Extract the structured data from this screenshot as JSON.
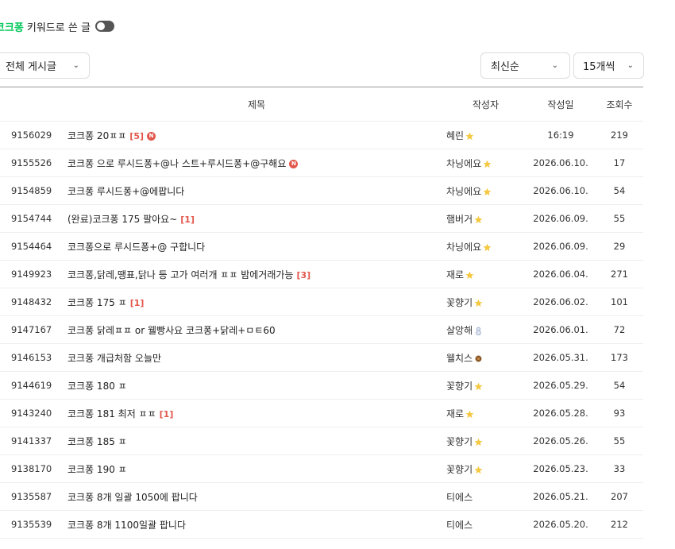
{
  "keyword_filter": {
    "keyword": "코크퐁",
    "label": "키워드로 쓴 글",
    "toggle_on": false
  },
  "filters": {
    "board_select": "전체 게시글",
    "sort_select": "최신순",
    "count_select": "15개씩"
  },
  "table": {
    "headers": {
      "title": "제목",
      "author": "작성자",
      "date": "작성일",
      "views": "조회수"
    },
    "rows": [
      {
        "num": "9156029",
        "title": "코크퐁 20ㅍㅍ",
        "comments": "[5]",
        "is_new": true,
        "new_label": "N",
        "author": "혜린",
        "level_icon": "star-level-icon",
        "date": "16:19",
        "views": "219"
      },
      {
        "num": "9155526",
        "title": "코크퐁 으로 루시드퐁+@나 스트+루시드퐁+@구해요",
        "comments": "",
        "is_new": true,
        "new_label": "N",
        "author": "차닝에요",
        "level_icon": "star-level-icon",
        "date": "2026.06.10.",
        "views": "17"
      },
      {
        "num": "9154859",
        "title": "코크퐁 루시드퐁+@에팝니다",
        "comments": "",
        "is_new": false,
        "new_label": "",
        "author": "차닝에요",
        "level_icon": "star-level-icon",
        "date": "2026.06.10.",
        "views": "54"
      },
      {
        "num": "9154744",
        "title": "(완료)코크퐁 175 팔아요~",
        "comments": "[1]",
        "is_new": false,
        "new_label": "",
        "author": "햄버거",
        "level_icon": "star-level-icon",
        "date": "2026.06.09.",
        "views": "55"
      },
      {
        "num": "9154464",
        "title": "코크퐁으로 루시드퐁+@ 구합니다",
        "comments": "",
        "is_new": false,
        "new_label": "",
        "author": "차닝에요",
        "level_icon": "star-level-icon",
        "date": "2026.06.09.",
        "views": "29"
      },
      {
        "num": "9149923",
        "title": "코크퐁,닭레,땡표,닭나 등 고가 여러개 ㅍㅍ 밤에거래가능",
        "comments": "[3]",
        "is_new": false,
        "new_label": "",
        "author": "재로",
        "level_icon": "star-level-icon",
        "date": "2026.06.04.",
        "views": "271"
      },
      {
        "num": "9148432",
        "title": "코크퐁 175 ㅍ",
        "comments": "[1]",
        "is_new": false,
        "new_label": "",
        "author": "꽃향기",
        "level_icon": "star-level-icon",
        "date": "2026.06.02.",
        "views": "101"
      },
      {
        "num": "9147167",
        "title": "코크퐁 닭레ㅍㅍ or 웰빵사요 코크퐁+닭레+ㅁㅌ60",
        "comments": "",
        "is_new": false,
        "new_label": "",
        "author": "살앙해",
        "level_icon": "snowman-level-icon",
        "date": "2026.06.01.",
        "views": "72"
      },
      {
        "num": "9146153",
        "title": "코크퐁 개급처함 오늘만",
        "comments": "",
        "is_new": false,
        "new_label": "",
        "author": "웰치스",
        "level_icon": "acorn-level-icon",
        "date": "2026.05.31.",
        "views": "173"
      },
      {
        "num": "9144619",
        "title": "코크퐁 180 ㅍ",
        "comments": "",
        "is_new": false,
        "new_label": "",
        "author": "꽃향기",
        "level_icon": "star-level-icon",
        "date": "2026.05.29.",
        "views": "54"
      },
      {
        "num": "9143240",
        "title": "코크퐁 181 최저 ㅍㅍ",
        "comments": "[1]",
        "is_new": false,
        "new_label": "",
        "author": "재로",
        "level_icon": "star-level-icon",
        "date": "2026.05.28.",
        "views": "93"
      },
      {
        "num": "9141337",
        "title": "코크퐁 185 ㅍ",
        "comments": "",
        "is_new": false,
        "new_label": "",
        "author": "꽃향기",
        "level_icon": "star-level-icon",
        "date": "2026.05.26.",
        "views": "55"
      },
      {
        "num": "9138170",
        "title": "코크퐁 190 ㅍ",
        "comments": "",
        "is_new": false,
        "new_label": "",
        "author": "꽃향기",
        "level_icon": "star-level-icon",
        "date": "2026.05.23.",
        "views": "33"
      },
      {
        "num": "9135587",
        "title": "코크퐁 8개 일괄 1050에 팝니다",
        "comments": "",
        "is_new": false,
        "new_label": "",
        "author": "티에스",
        "level_icon": "",
        "date": "2026.05.21.",
        "views": "207"
      },
      {
        "num": "9135539",
        "title": "코크퐁 8개 1100일괄 팝니다",
        "comments": "",
        "is_new": false,
        "new_label": "",
        "author": "티에스",
        "level_icon": "",
        "date": "2026.05.20.",
        "views": "212"
      }
    ]
  },
  "colors": {
    "accent": "#03c75a",
    "comment_red": "#e2574c",
    "star": "#f5c842",
    "snowman": "#9aa9c6",
    "acorn": "#8b5a2b"
  }
}
